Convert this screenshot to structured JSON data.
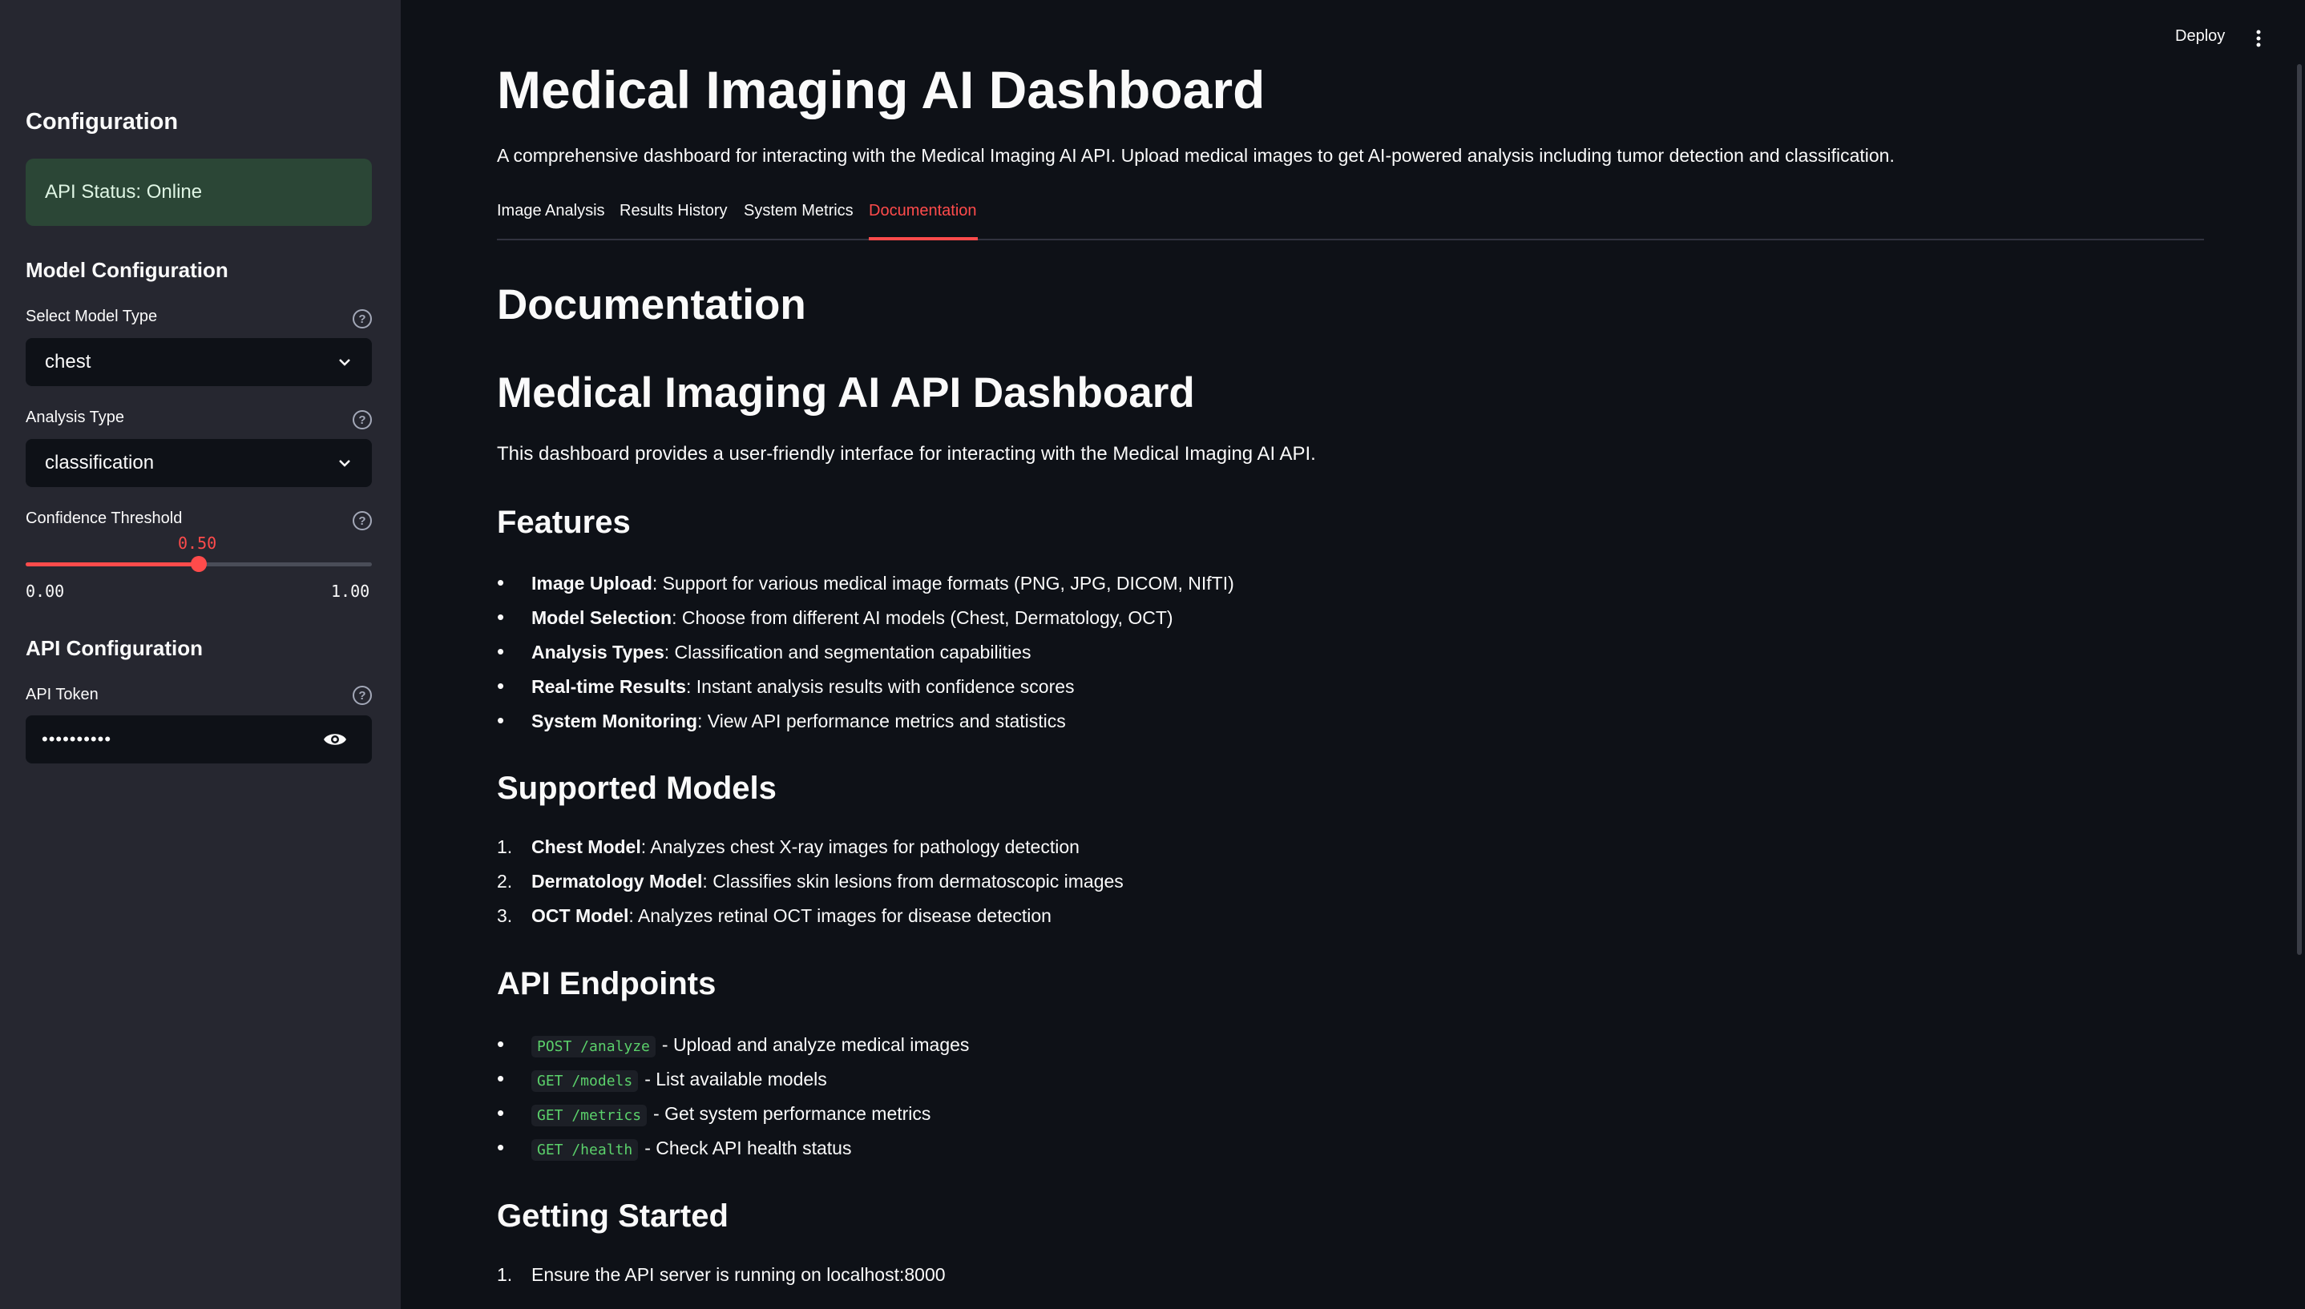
{
  "sidebar": {
    "config_title": "Configuration",
    "api_status": "API Status: Online",
    "model_config_title": "Model Configuration",
    "model_type_label": "Select Model Type",
    "model_type_value": "chest",
    "analysis_type_label": "Analysis Type",
    "analysis_type_value": "classification",
    "confidence_label": "Confidence Threshold",
    "confidence_value": "0.50",
    "confidence_fraction": 0.5,
    "confidence_min": "0.00",
    "confidence_max": "1.00",
    "api_config_title": "API Configuration",
    "api_token_label": "API Token",
    "api_token_value": "••••••••••"
  },
  "header": {
    "deploy_label": "Deploy"
  },
  "main": {
    "title": "Medical Imaging AI Dashboard",
    "subtitle": "A comprehensive dashboard for interacting with the Medical Imaging AI API. Upload medical images to get AI-powered analysis including tumor detection and classification.",
    "tabs": [
      {
        "label": "Image Analysis"
      },
      {
        "label": "Results History"
      },
      {
        "label": "System Metrics"
      },
      {
        "label": "Documentation"
      }
    ],
    "doc_title": "Documentation",
    "doc_heading": "Medical Imaging AI API Dashboard",
    "doc_intro": "This dashboard provides a user-friendly interface for interacting with the Medical Imaging AI API.",
    "features_title": "Features",
    "features": [
      {
        "name": "Image Upload",
        "desc": ": Support for various medical image formats (PNG, JPG, DICOM, NIfTI)"
      },
      {
        "name": "Model Selection",
        "desc": ": Choose from different AI models (Chest, Dermatology, OCT)"
      },
      {
        "name": "Analysis Types",
        "desc": ": Classification and segmentation capabilities"
      },
      {
        "name": "Real-time Results",
        "desc": ": Instant analysis results with confidence scores"
      },
      {
        "name": "System Monitoring",
        "desc": ": View API performance metrics and statistics"
      }
    ],
    "models_title": "Supported Models",
    "models": [
      {
        "num": "1.",
        "name": "Chest Model",
        "desc": ": Analyzes chest X-ray images for pathology detection"
      },
      {
        "num": "2.",
        "name": "Dermatology Model",
        "desc": ": Classifies skin lesions from dermatoscopic images"
      },
      {
        "num": "3.",
        "name": "OCT Model",
        "desc": ": Analyzes retinal OCT images for disease detection"
      }
    ],
    "endpoints_title": "API Endpoints",
    "endpoints": [
      {
        "code": "POST /analyze",
        "desc": "- Upload and analyze medical images"
      },
      {
        "code": "GET /models",
        "desc": "- List available models"
      },
      {
        "code": "GET /metrics",
        "desc": "- Get system performance metrics"
      },
      {
        "code": "GET /health",
        "desc": "- Check API health status"
      }
    ],
    "getting_started_title": "Getting Started",
    "steps": [
      {
        "num": "1.",
        "text": "Ensure the API server is running on localhost:8000"
      }
    ]
  }
}
